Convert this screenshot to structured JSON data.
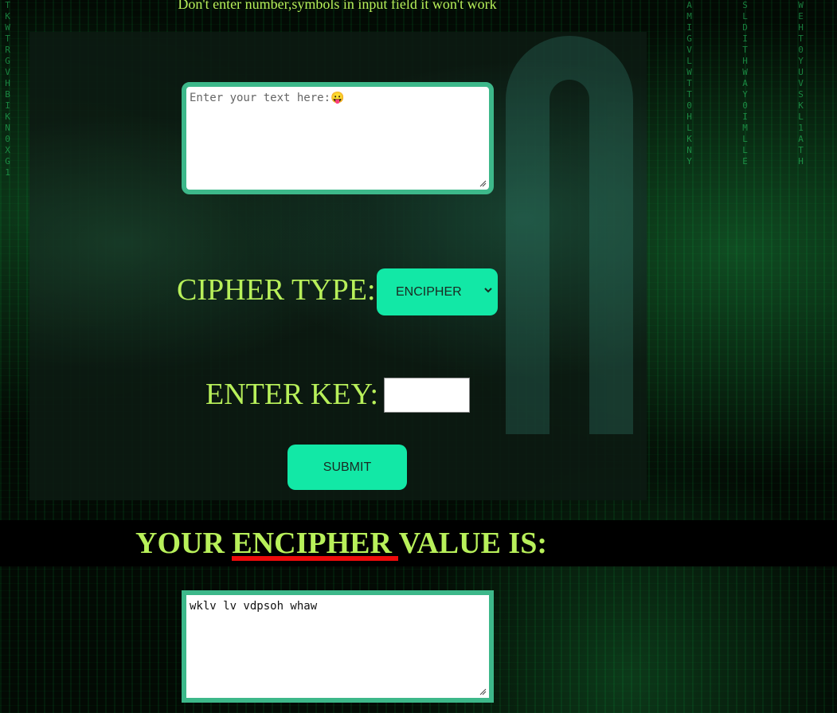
{
  "warning_text": "Don't enter number,symbols in input field it won't work",
  "input": {
    "placeholder": "Enter your text here:",
    "emoji": "😛",
    "value": ""
  },
  "cipher_type": {
    "label": "CIPHER TYPE:",
    "selected": "ENCIPHER"
  },
  "key": {
    "label": "ENTER KEY:",
    "value": ""
  },
  "submit_label": "SUBMIT",
  "result": {
    "prefix": "YOUR",
    "mode": "ENCIPHER",
    "suffix": "VALUE IS:",
    "output": "wklv lv vdpsoh whaw"
  },
  "colors": {
    "accent": "#12e8a6",
    "label_text": "#b8f05a",
    "textarea_border": "#3db88a",
    "underline": "#ee0b0b"
  },
  "icons": {
    "select_arrow": "chevron-down-icon",
    "resize": "resize-grip-icon"
  }
}
